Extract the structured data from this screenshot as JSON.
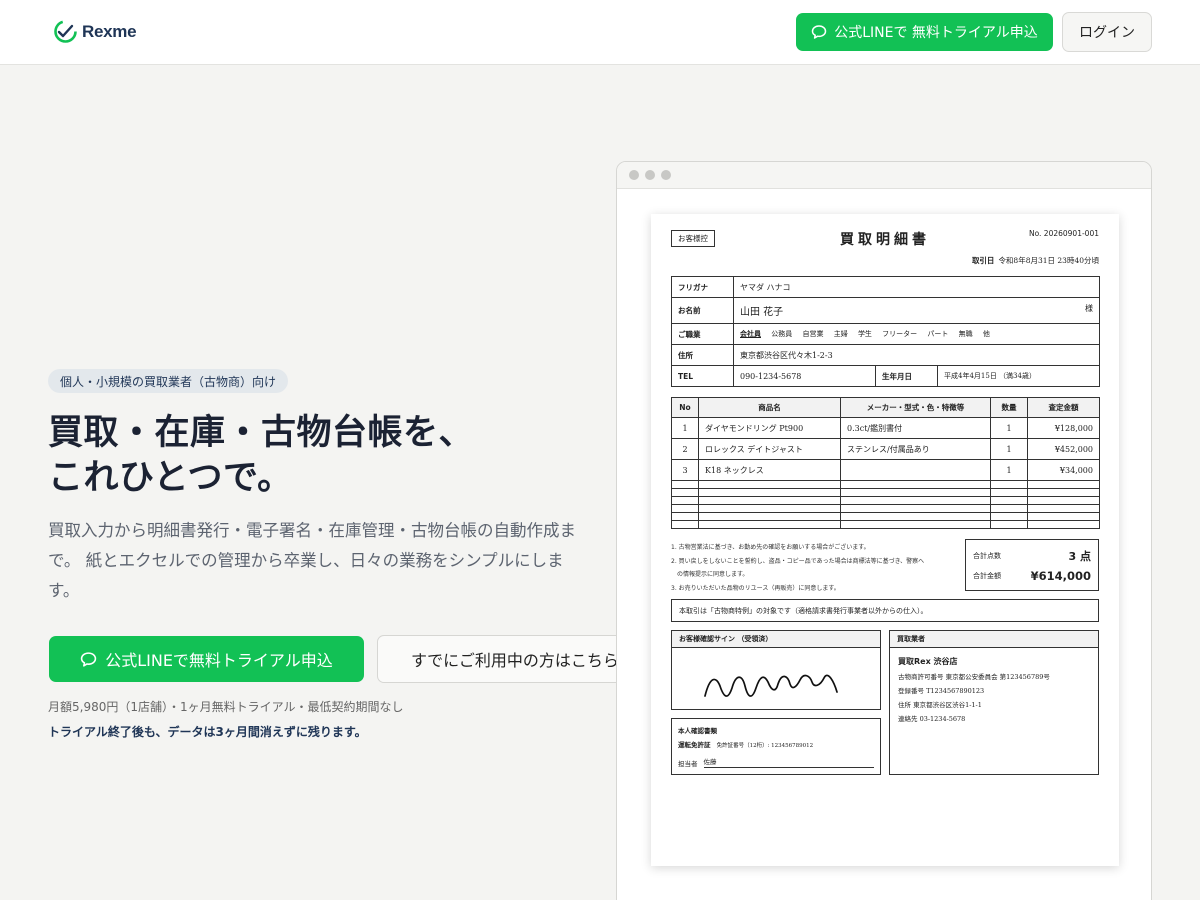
{
  "header": {
    "brand": "Rexme",
    "line_button": "公式LINEで 無料トライアル申込",
    "login_button": "ログイン"
  },
  "hero": {
    "badge": "個人・小規模の買取業者（古物商）向け",
    "title_line1": "買取・在庫・古物台帳を、",
    "title_line2": "これひとつで。",
    "description": "買取入力から明細書発行・電子署名・在庫管理・古物台帳の自動作成まで。 紙とエクセルでの管理から卒業し、日々の業務をシンプルにします。",
    "cta_primary": "公式LINEで無料トライアル申込",
    "cta_secondary": "すでにご利用中の方はこちら",
    "price_note": "月額5,980円（1店舗）・1ヶ月無料トライアル・最低契約期間なし",
    "trial_note": "トライアル終了後も、データは3ヶ月間消えずに残ります。"
  },
  "document": {
    "copy_tag": "お客様控",
    "title": "買取明細書",
    "number": "No. 20260901-001",
    "date_label": "取引日",
    "date_value": "令和8年8月31日 23時40分頃",
    "customer": {
      "furigana_label": "フリガナ",
      "furigana": "ヤマダ ハナコ",
      "name_label": "お名前",
      "name": "山田 花子",
      "honorific": "様",
      "job_label": "ご職業",
      "job_options": [
        "会社員",
        "公務員",
        "自営業",
        "主婦",
        "学生",
        "フリーター",
        "パート",
        "無職",
        "他"
      ],
      "address_label": "住所",
      "address": "東京都渋谷区代々木1-2-3",
      "tel_label": "TEL",
      "tel": "090-1234-5678",
      "birth_label": "生年月日",
      "birth": "平成4年4月15日 （満34歳）"
    },
    "items_headers": [
      "No",
      "商品名",
      "メーカー・型式・色・特徴等",
      "数量",
      "査定金額"
    ],
    "items": [
      {
        "no": "1",
        "name": "ダイヤモンドリング Pt900",
        "detail": "0.3ct/鑑別書付",
        "qty": "1",
        "price": "¥128,000"
      },
      {
        "no": "2",
        "name": "ロレックス デイトジャスト",
        "detail": "ステンレス/付属品あり",
        "qty": "1",
        "price": "¥452,000"
      },
      {
        "no": "3",
        "name": "K18 ネックレス",
        "detail": "",
        "qty": "1",
        "price": "¥34,000"
      }
    ],
    "notes": [
      "1. 古物営業法に基づき、お勤め先の確認をお願いする場合がございます。",
      "2. 買い戻しをしないことを誓約し、盗品・コピー品であった場合は商標法等に基づき、警察へ",
      "　の情報提示に同意します。",
      "3. お売りいただいた品物のリユース（再販売）に同意します。"
    ],
    "total_count_label": "合計点数",
    "total_count": "3 点",
    "total_amount_label": "合計金額",
    "total_amount": "¥614,000",
    "tax_note": "本取引は「古物商特例」の対象です（適格請求書発行事業者以外からの仕入）。",
    "sign_label": "お客様確認サイン （受領済）",
    "id_title": "本人確認書類",
    "id_type": "運転免許証",
    "id_number": "免許証番号（12桁）: 123456789012",
    "staff_label": "担当者",
    "staff_name": "佐藤",
    "buyer_label": "買取業者",
    "buyer_name": "買取Rex 渋谷店",
    "buyer_license": "古物商許可番号 東京都公安委員会 第123456789号",
    "buyer_reg": "登録番号 T1234567890123",
    "buyer_address": "住所 東京都渋谷区渋谷1-1-1",
    "buyer_contact": "連絡先 03-1234-5678"
  },
  "colors": {
    "line_green": "#12c155",
    "brand_navy": "#1f3556",
    "background": "#f4f4f2"
  }
}
